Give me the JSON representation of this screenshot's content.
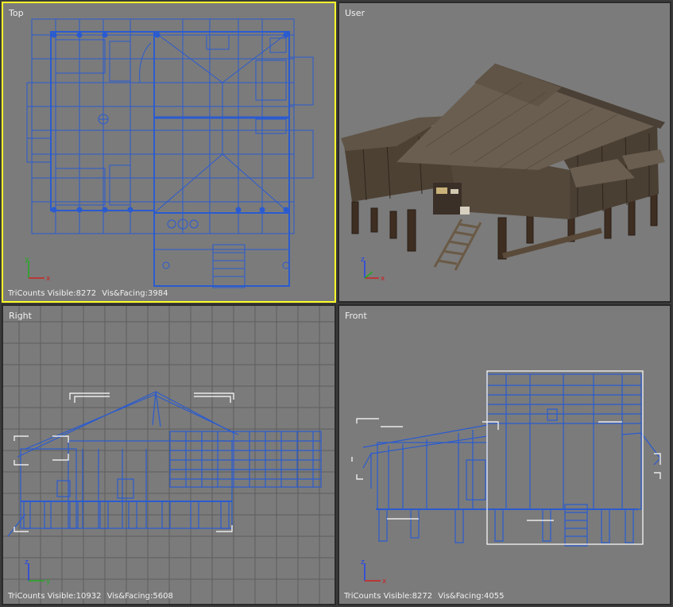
{
  "colors": {
    "viewport_bg": "#7b7b7b",
    "active_border": "#ffff2a",
    "wire": "#2a5bd0",
    "selection": "#ffffff",
    "grid": "#5e5e5e",
    "axis_x": "#cc2222",
    "axis_y": "#22aa22",
    "axis_z": "#2244ee"
  },
  "viewports": [
    {
      "label": "Top",
      "active": true,
      "stats": {
        "visible": "TriCounts Visible:8272",
        "facing": "Vis&Facing:3984"
      },
      "axes": {
        "h": "x",
        "v": "y"
      }
    },
    {
      "label": "User",
      "active": false,
      "stats": {
        "visible": "",
        "facing": ""
      },
      "axes": {
        "h": "x",
        "v": "z"
      }
    },
    {
      "label": "Right",
      "active": false,
      "stats": {
        "visible": "TriCounts Visible:10932",
        "facing": "Vis&Facing:5608"
      },
      "axes": {
        "h": "y",
        "v": "z"
      }
    },
    {
      "label": "Front",
      "active": false,
      "stats": {
        "visible": "TriCounts Visible:8272",
        "facing": "Vis&Facing:4055"
      },
      "axes": {
        "h": "x",
        "v": "z"
      }
    }
  ]
}
